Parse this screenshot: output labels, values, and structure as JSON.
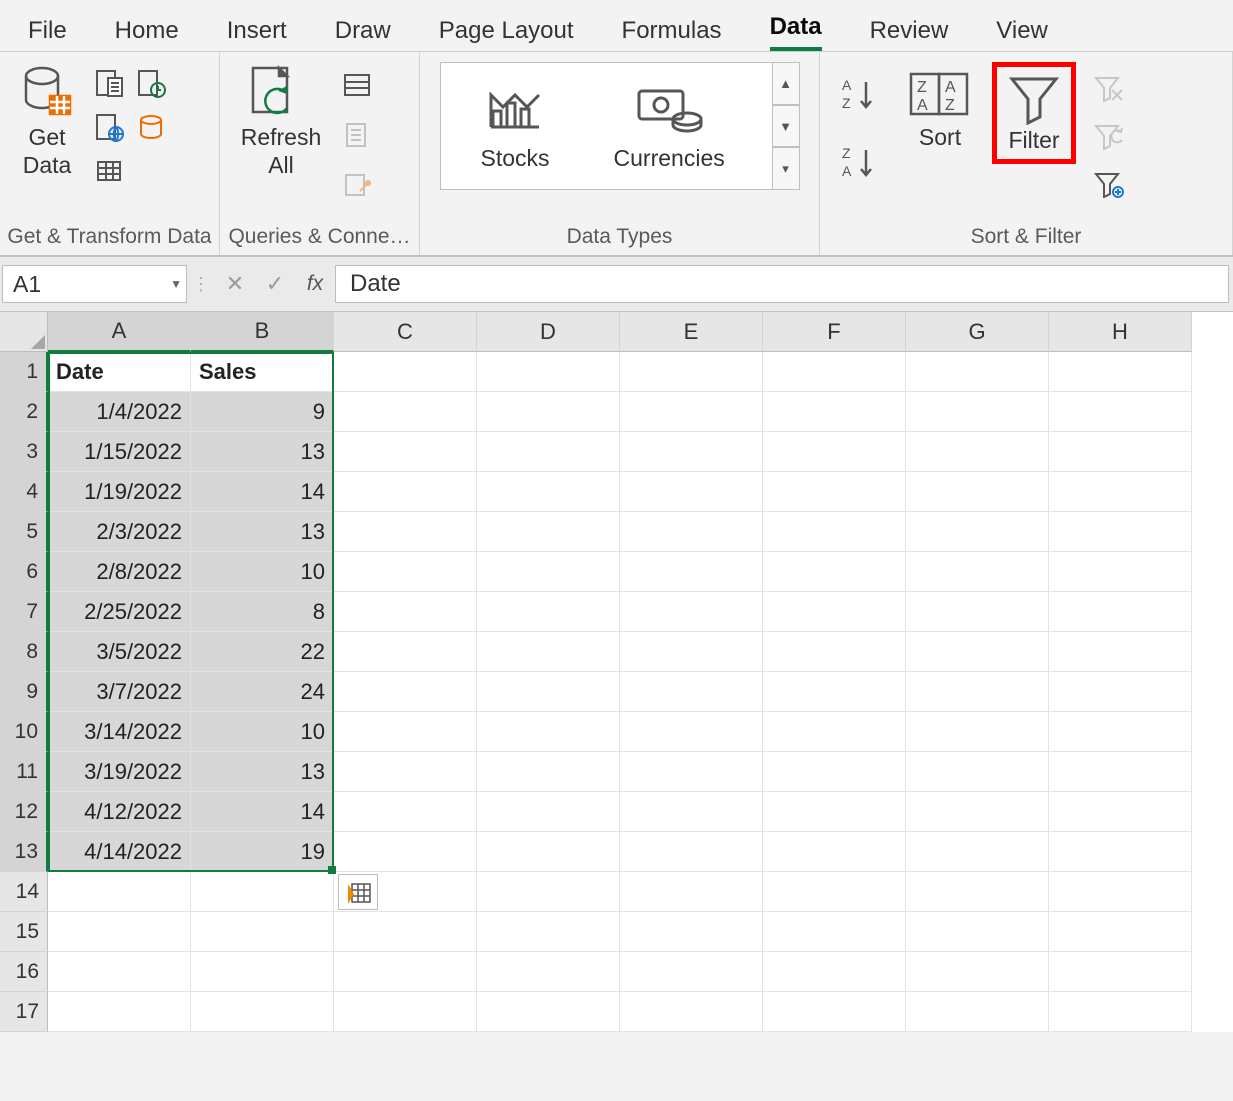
{
  "tabs": {
    "file": "File",
    "home": "Home",
    "insert": "Insert",
    "draw": "Draw",
    "page_layout": "Page Layout",
    "formulas": "Formulas",
    "data": "Data",
    "review": "Review",
    "view": "View"
  },
  "ribbon": {
    "get_data": "Get\nData",
    "refresh_all": "Refresh\nAll",
    "stocks": "Stocks",
    "currencies": "Currencies",
    "sort": "Sort",
    "filter": "Filter",
    "group_labels": {
      "get_transform": "Get & Transform Data",
      "queries": "Queries & Conne…",
      "data_types": "Data Types",
      "sort_filter": "Sort & Filter"
    }
  },
  "formula_bar": {
    "name_box": "A1",
    "content": "Date"
  },
  "columns": [
    "A",
    "B",
    "C",
    "D",
    "E",
    "F",
    "G",
    "H"
  ],
  "row_numbers": [
    1,
    2,
    3,
    4,
    5,
    6,
    7,
    8,
    9,
    10,
    11,
    12,
    13,
    14,
    15,
    16,
    17
  ],
  "headers": {
    "A": "Date",
    "B": "Sales"
  },
  "data_rows": [
    {
      "date": "1/4/2022",
      "sales": 9
    },
    {
      "date": "1/15/2022",
      "sales": 13
    },
    {
      "date": "1/19/2022",
      "sales": 14
    },
    {
      "date": "2/3/2022",
      "sales": 13
    },
    {
      "date": "2/8/2022",
      "sales": 10
    },
    {
      "date": "2/25/2022",
      "sales": 8
    },
    {
      "date": "3/5/2022",
      "sales": 22
    },
    {
      "date": "3/7/2022",
      "sales": 24
    },
    {
      "date": "3/14/2022",
      "sales": 10
    },
    {
      "date": "3/19/2022",
      "sales": 13
    },
    {
      "date": "4/12/2022",
      "sales": 14
    },
    {
      "date": "4/14/2022",
      "sales": 19
    }
  ],
  "chart_data": {
    "type": "table",
    "title": "Date vs Sales",
    "columns": [
      "Date",
      "Sales"
    ],
    "rows": [
      [
        "1/4/2022",
        9
      ],
      [
        "1/15/2022",
        13
      ],
      [
        "1/19/2022",
        14
      ],
      [
        "2/3/2022",
        13
      ],
      [
        "2/8/2022",
        10
      ],
      [
        "2/25/2022",
        8
      ],
      [
        "3/5/2022",
        22
      ],
      [
        "3/7/2022",
        24
      ],
      [
        "3/14/2022",
        10
      ],
      [
        "3/19/2022",
        13
      ],
      [
        "4/12/2022",
        14
      ],
      [
        "4/14/2022",
        19
      ]
    ]
  }
}
